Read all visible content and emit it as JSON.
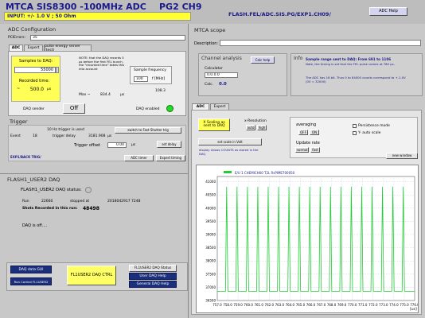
{
  "header": {
    "title": "MTCA SIS8300 -100MHz ADC",
    "subtitle": "PG2 CH9",
    "input_range": "INPUT: +/- 1.0 V ; 50 Ohm",
    "path": "FLASH.FEL/ADC.SIS.PG/EXP1.CH09/",
    "help_button": "ADC Help"
  },
  "adc_config": {
    "title": "ADC Configuration",
    "pcie_label": "PCIErrors:",
    "pcie_value": "35",
    "tabs": [
      "ADC",
      "Expert",
      "pulse energy server (test)"
    ],
    "samples_label": "Samples to DAQ:",
    "samples_value": "55000",
    "recorded_label": "Recorded time:",
    "recorded_value": "500.0",
    "recorded_unit": "µs",
    "note": "NOTE: that the DAQ records 5 µs before the first FEL bunch, the \"recorded time\" takes this into account",
    "max_label": "Max ~",
    "max_value": "834.4",
    "max_unit": "µs",
    "freq_title": "Sample frequency",
    "freq_value": "100",
    "freq_unit": "f [MHz]",
    "freq_value2": "108.3",
    "daq_sender_label": "DAQ sender",
    "daq_sender_value": "Off",
    "daq_enabled_label": "DAQ enabled"
  },
  "trigger": {
    "title": "Trigger",
    "mode_text": "10 Hz trigger is used",
    "switch_button": "switch to Fast Shutter  trig",
    "event_label": "Event",
    "event_value": "18",
    "delay_label": "trigger delay",
    "delay_value": "3181.908",
    "delay_unit": "µs",
    "offset_label": "Trigger offset",
    "offset_value": "0.00",
    "offset_unit": "µs",
    "set_delay": "set delay",
    "exp_trig": "EXP1/BACK TRIG/",
    "adc_timer": "ADC timer",
    "expert_timing": "Expert timing"
  },
  "flash_daq": {
    "title": "FLASH1_USER2 DAQ",
    "status_label": "FLASH1_USER2 DAQ status:",
    "run_label": "Run",
    "run_value": "22660",
    "stopped_label": "stopped at",
    "stopped_value": "2018042917 7248",
    "shots_label": "Shots Recorded in this run:",
    "shots_value": "48498",
    "daq_off": "DAQ is off...."
  },
  "bottom": {
    "daq_gui": "DAQ data GUI",
    "run_control": "Run Control FL1USER2",
    "ctrl_button": "FL1USER2 DAQ CTRL",
    "status_btn": "FL1USER2 DAQ Status",
    "user_help": "User DAQ Help",
    "general_help": "General DAQ Help"
  },
  "mtca_scope": {
    "title": "MTCA scope",
    "description_label": "Description:",
    "description_value": ""
  },
  "channel_analysis": {
    "title": "Channel analysis",
    "calc_help": "Calc help",
    "calculator_label": "Calculator",
    "calculator_value": "0.0.0.0",
    "calc_label": "Calc.",
    "calc_value": "0.0"
  },
  "info": {
    "title": "Info",
    "range_line": "Sample range sent to DAQ:  From   691  to  1106",
    "note_line": "Note, the timing is set that the FEL pulse comes at 780 µs.",
    "adc_line": "The ADC has 16 bit. Thus 0 to 64000 counts correspond to +-1.0V (0V = 32000)"
  },
  "scope_tabs": [
    "ADC",
    "Expert"
  ],
  "scope_controls": {
    "x_scaling": "X Scaling as sent to DAQ",
    "x_resolution": "x-Resolution",
    "res_auto": "auto",
    "res_high": "high",
    "set_scale": "set scale in Volt",
    "display_note": "display shows COUNTS as stored in the DAQ",
    "averaging": "averaging",
    "avg_off": "OFF",
    "avg_on": "ON",
    "update_rate": "Update rate",
    "upd_normal": "normal",
    "upd_fast": "fast",
    "persistence": "Persistence mode",
    "y_autoscale": "Y- auto scale",
    "new_window": "new window"
  },
  "chart_data": {
    "type": "line",
    "title": "",
    "legend": "E/U 1 CHEMICH60 T2L RsPIME700050",
    "xlabel": "[us]",
    "ylabel": "",
    "xlim": [
      757.0,
      776.0
    ],
    "ylim": [
      36500,
      41200
    ],
    "x_ticks": [
      757.0,
      758.0,
      759.0,
      760.0,
      761.0,
      762.0,
      763.0,
      764.0,
      765.0,
      766.0,
      767.0,
      768.0,
      769.0,
      770.0,
      771.0,
      772.0,
      773.0,
      774.0,
      775.0,
      776.0
    ],
    "y_ticks": [
      36500,
      37000,
      37500,
      38000,
      38500,
      39000,
      39500,
      40000,
      40500,
      41000
    ],
    "baseline": 36850,
    "peaks": [
      {
        "x": 757.9,
        "y": 40800
      },
      {
        "x": 758.9,
        "y": 40800
      },
      {
        "x": 759.9,
        "y": 40800
      },
      {
        "x": 760.9,
        "y": 40800
      },
      {
        "x": 761.9,
        "y": 40800
      },
      {
        "x": 762.9,
        "y": 40800
      },
      {
        "x": 763.9,
        "y": 40800
      },
      {
        "x": 764.9,
        "y": 40800
      },
      {
        "x": 765.9,
        "y": 40800
      },
      {
        "x": 766.9,
        "y": 40800
      },
      {
        "x": 767.9,
        "y": 40800
      },
      {
        "x": 768.9,
        "y": 40800
      },
      {
        "x": 769.9,
        "y": 40800
      },
      {
        "x": 770.9,
        "y": 40800
      },
      {
        "x": 771.9,
        "y": 40800
      },
      {
        "x": 772.9,
        "y": 40800
      },
      {
        "x": 773.9,
        "y": 40800
      },
      {
        "x": 774.9,
        "y": 40800
      }
    ],
    "line_color": "#22cc33",
    "grid": true
  }
}
